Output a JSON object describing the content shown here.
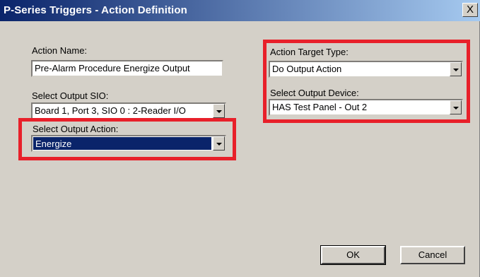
{
  "window": {
    "title": "P-Series Triggers - Action Definition",
    "close_label": "X"
  },
  "action_name": {
    "label": "Action Name:",
    "value": "Pre-Alarm Procedure Energize Output"
  },
  "output_sio": {
    "label": "Select Output SIO:",
    "value": "Board 1, Port 3, SIO 0 : 2-Reader I/O"
  },
  "output_action": {
    "label": "Select Output Action:",
    "value": "Energize"
  },
  "target_type": {
    "label": "Action Target Type:",
    "value": "Do Output Action"
  },
  "output_device": {
    "label": "Select Output Device:",
    "value": "HAS Test Panel - Out 2"
  },
  "buttons": {
    "ok": "OK",
    "cancel": "Cancel"
  },
  "colors": {
    "title_bar": "#0a246a",
    "dialog_bg": "#d4d0c8",
    "highlight_box": "#e8202a",
    "selection": "#0a246a"
  }
}
